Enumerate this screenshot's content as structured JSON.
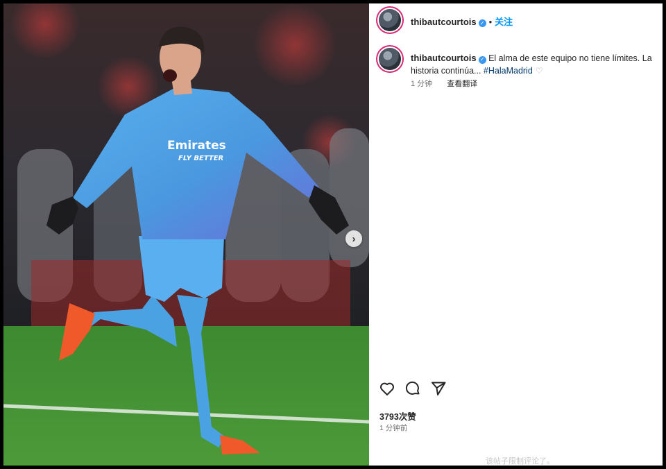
{
  "post": {
    "username": "thibautcourtois",
    "verified_icon": "verified-badge-icon",
    "separator": "•",
    "follow_label": "关注",
    "caption_text": "El alma de este equipo no tiene límites. La historia continúa... ",
    "hashtag": "#HalaMadrid",
    "caption_time": "1 分钟",
    "translate_label": "查看翻译",
    "likes": "3793次赞",
    "post_time": "1 分钟前",
    "comments_note": "该帖子限制评论了。"
  },
  "photo": {
    "jersey_sponsor": "Emirates",
    "jersey_slogan": "FLY BETTER",
    "next_icon": "chevron-right-icon"
  },
  "icons": {
    "like": "heart-icon",
    "comment": "comment-bubble-icon",
    "share": "send-icon"
  },
  "colors": {
    "accent": "#0095f6",
    "kit": "#4aa2e3",
    "pitch": "#3f8f33",
    "boots": "#f05a2a"
  }
}
